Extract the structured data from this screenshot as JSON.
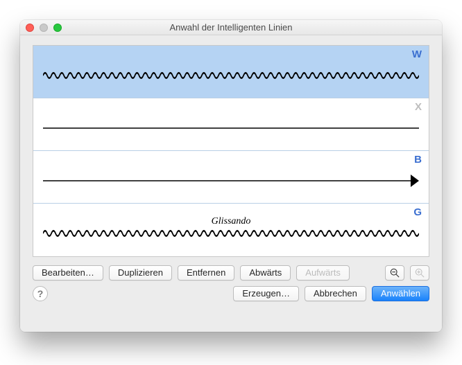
{
  "window": {
    "title": "Anwahl der Intelligenten Linien"
  },
  "list": {
    "rows": [
      {
        "letter": "W",
        "letterGray": false,
        "selected": true,
        "shape": "wavy",
        "label": ""
      },
      {
        "letter": "X",
        "letterGray": true,
        "selected": false,
        "shape": "line",
        "label": ""
      },
      {
        "letter": "B",
        "letterGray": false,
        "selected": false,
        "shape": "arrow",
        "label": ""
      },
      {
        "letter": "G",
        "letterGray": false,
        "selected": false,
        "shape": "wavy",
        "label": "Glissando"
      }
    ]
  },
  "buttons": {
    "edit": "Bearbeiten…",
    "duplicate": "Duplizieren",
    "remove": "Entfernen",
    "down": "Abwärts",
    "up": "Aufwärts",
    "create": "Erzeugen…",
    "cancel": "Abbrechen",
    "select": "Anwählen"
  }
}
